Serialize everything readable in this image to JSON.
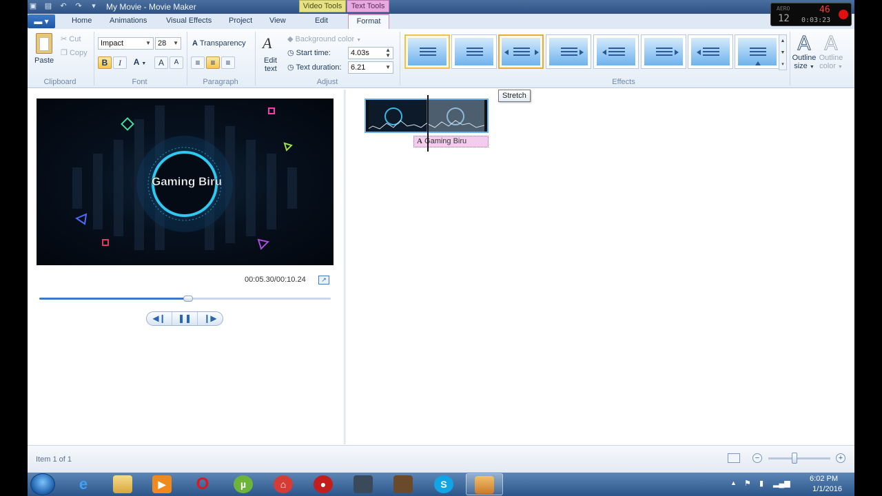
{
  "window": {
    "title": "My Movie - Movie Maker",
    "context_video_tools": "Video Tools",
    "context_text_tools": "Text Tools"
  },
  "tabs": {
    "home": "Home",
    "animations": "Animations",
    "visual_effects": "Visual Effects",
    "project": "Project",
    "view": "View",
    "edit": "Edit",
    "format": "Format"
  },
  "ribbon": {
    "clipboard": {
      "label": "Clipboard",
      "paste": "Paste",
      "cut": "Cut",
      "copy": "Copy"
    },
    "font": {
      "label": "Font",
      "family": "Impact",
      "size": "28",
      "bold": "B",
      "italic": "I",
      "color": "A",
      "grow": "A",
      "shrink": "A"
    },
    "paragraph": {
      "label": "Paragraph",
      "transparency": "Transparency"
    },
    "adjust": {
      "label": "Adjust",
      "edit_text_line1": "Edit",
      "edit_text_line2": "text",
      "background_color": "Background color",
      "start_time_label": "Start time:",
      "start_time_value": "4.03s",
      "text_duration_label": "Text duration:",
      "text_duration_value": "6.21"
    },
    "effects": {
      "label": "Effects",
      "selected_index": 2
    },
    "outline_size_line1": "Outline",
    "outline_size_line2": "size",
    "outline_color_line1": "Outline",
    "outline_color_line2": "color"
  },
  "tooltip": "Stretch",
  "preview": {
    "title_text": "Gaming Biru",
    "timecode": "00:05.30/00:10.24",
    "progress_fraction": 0.51
  },
  "storyboard": {
    "caption": "Gaming Biru"
  },
  "statusbar": {
    "item_text": "Item 1 of 1",
    "zoom_fraction": 0.42
  },
  "taskbar": {
    "time": "6:02 PM",
    "date": "1/1/2016"
  },
  "fraps": {
    "label": "AERO",
    "fps": "12",
    "counter": "46",
    "timer": "0:03:23"
  },
  "colors": {
    "accent": "#3b78c7",
    "selected_effect_border": "#e7ac3b",
    "text_tools": "#e8a8e0",
    "video_tools": "#e6e385",
    "ring_glow": "#2ec8f0"
  }
}
